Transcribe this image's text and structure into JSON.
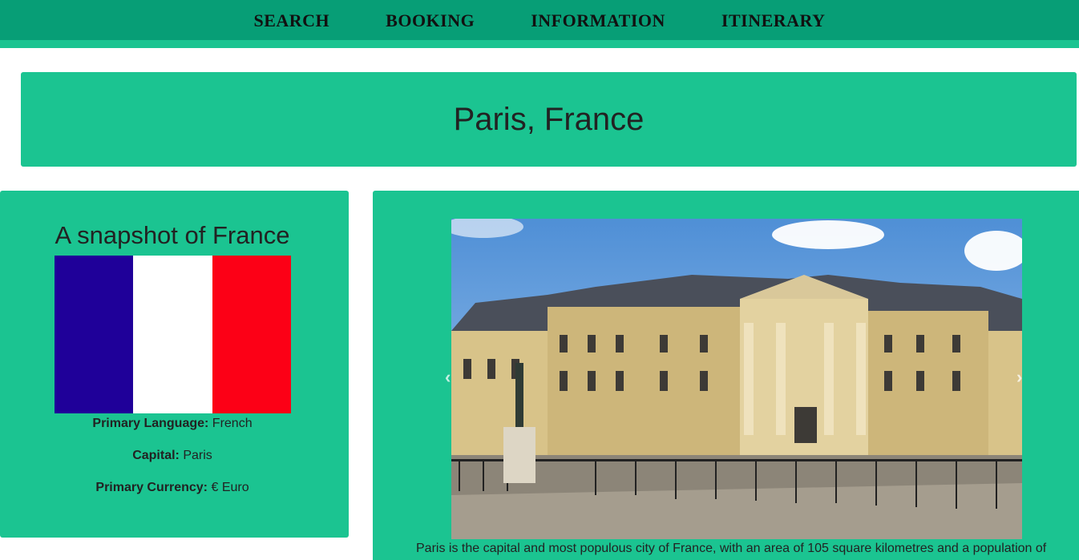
{
  "nav": {
    "items": [
      "SEARCH",
      "BOOKING",
      "INFORMATION",
      "ITINERARY"
    ]
  },
  "banner": {
    "title": "Paris, France"
  },
  "snapshot": {
    "heading": "A snapshot of France",
    "flag_colors": [
      "#1f0099",
      "#ffffff",
      "#fc0016"
    ],
    "facts": [
      {
        "label": "Primary Language:",
        "value": "French"
      },
      {
        "label": "Capital:",
        "value": "Paris"
      },
      {
        "label": "Primary Currency:",
        "value": "€ Euro"
      }
    ]
  },
  "gallery": {
    "prev_icon": "chevron-left-icon",
    "next_icon": "chevron-right-icon",
    "caption": "Paris is the capital and most populous city of France, with an area of 105 square kilometres and a population of"
  },
  "colors": {
    "accent": "#1bc491",
    "nav": "#079e76"
  }
}
